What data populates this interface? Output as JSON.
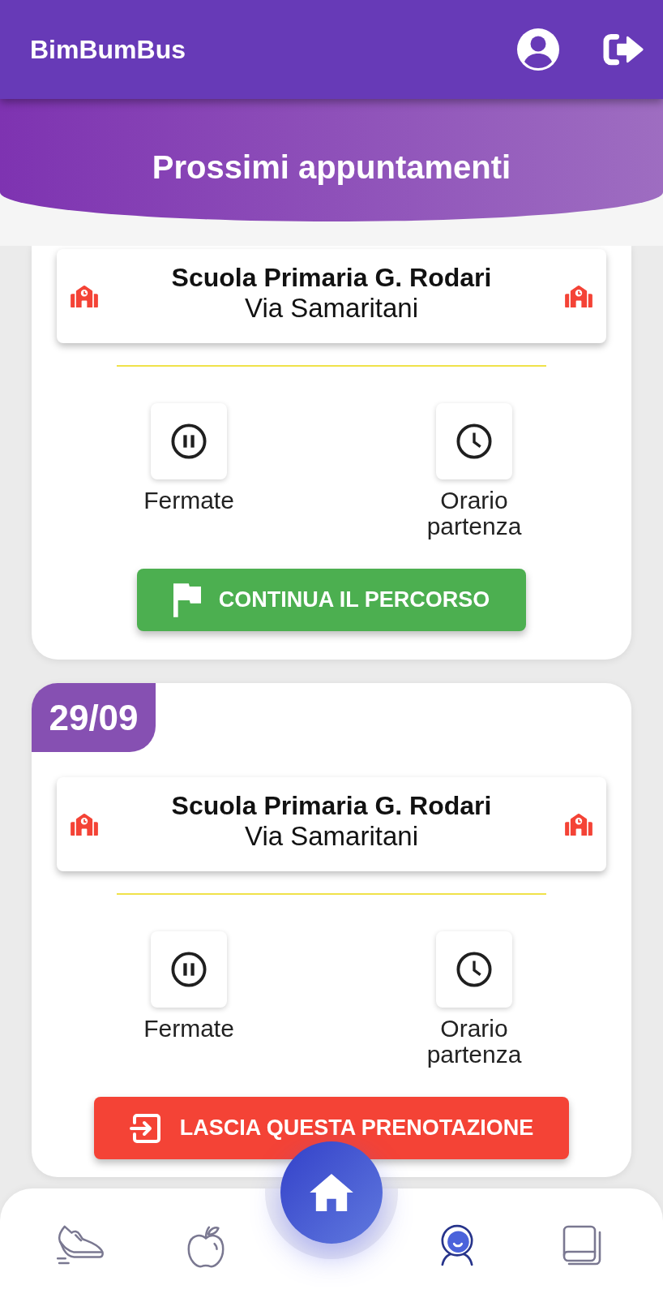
{
  "app_bar": {
    "title": "BimBumBus"
  },
  "banner": {
    "title": "Prossimi appuntamenti"
  },
  "appointments": [
    {
      "school": "Scuola Primaria G. Rodari",
      "address": "Via Samaritani",
      "info": [
        {
          "label": "Fermate"
        },
        {
          "label": "Orario partenza"
        }
      ],
      "action": {
        "kind": "continue",
        "label": "CONTINUA IL PERCORSO"
      }
    },
    {
      "date": "29/09",
      "school": "Scuola Primaria G. Rodari",
      "address": "Via Samaritani",
      "info": [
        {
          "label": "Fermate"
        },
        {
          "label": "Orario partenza"
        }
      ],
      "action": {
        "kind": "leave",
        "label": "LASCIA QUESTA PRENOTAZIONE"
      }
    }
  ],
  "bottom_nav": {
    "items": [
      {
        "selected": false
      },
      {
        "selected": false
      },
      {
        "selected": true
      },
      {
        "selected": false
      }
    ]
  }
}
